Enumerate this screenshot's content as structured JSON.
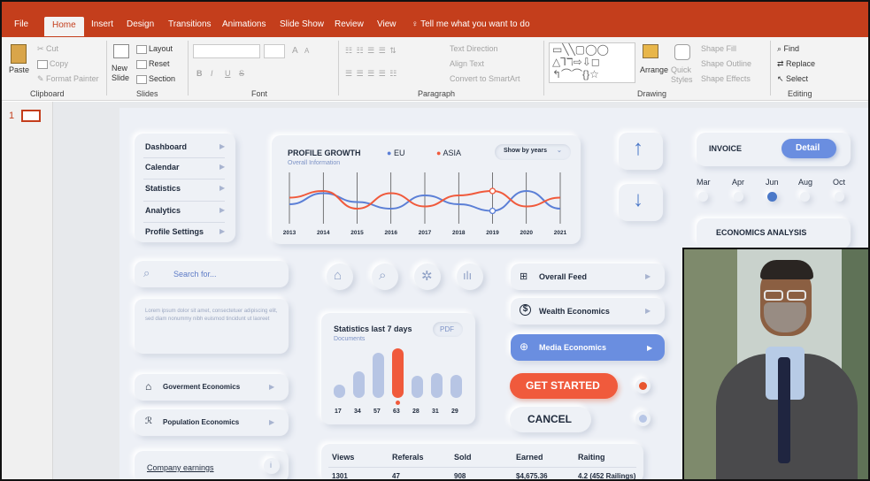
{
  "ribbon": {
    "tabs": [
      "File",
      "Home",
      "Insert",
      "Design",
      "Transitions",
      "Animations",
      "Slide Show",
      "Review",
      "View"
    ],
    "tell_me": "Tell me what you want to do",
    "clipboard": {
      "paste": "Paste",
      "cut": "Cut",
      "copy": "Copy",
      "format_painter": "Format Painter",
      "label": "Clipboard"
    },
    "slides": {
      "new_slide": "New Slide",
      "layout": "Layout",
      "reset": "Reset",
      "section": "Section",
      "label": "Slides"
    },
    "font": {
      "label": "Font",
      "bold": "B",
      "italic": "I",
      "underline": "U",
      "strike": "S",
      "size_up": "A",
      "size_down": "A"
    },
    "paragraph": {
      "label": "Paragraph",
      "text_direction": "Text Direction",
      "align_text": "Align Text",
      "convert": "Convert to SmartArt"
    },
    "drawing": {
      "label": "Drawing",
      "arrange": "Arrange",
      "quick_styles": "Quick Styles",
      "shape_fill": "Shape Fill",
      "shape_outline": "Shape Outline",
      "shape_effects": "Shape Effects"
    },
    "editing": {
      "label": "Editing",
      "find": "Find",
      "replace": "Replace",
      "select": "Select"
    }
  },
  "thumbs": {
    "slide_number": "1"
  },
  "slide": {
    "menu": [
      "Dashboard",
      "Calendar",
      "Statistics",
      "Analytics",
      "Profile Settings"
    ],
    "chart": {
      "title": "PROFILE GROWTH",
      "subtitle": "Overall Information",
      "legend_eu": "EU",
      "legend_asia": "ASIA",
      "dropdown": "Show by years",
      "years": [
        "2013",
        "2014",
        "2015",
        "2016",
        "2017",
        "2018",
        "2019",
        "2020",
        "2021"
      ]
    },
    "search_placeholder": "Search for...",
    "lorem": "Lorem ipsum dolor sit amet, consectetuer adipiscing elit, sed diam nonummy nibh euismod tincidunt ut laoreet",
    "feeds": [
      {
        "icon": "⊞",
        "label": "Overall Feed"
      },
      {
        "icon": "$",
        "label": "Wealth Economics"
      },
      {
        "icon": "⊕",
        "label": "Media Economics"
      }
    ],
    "stats": {
      "title": "Statistics last 7 days",
      "subtitle": "Documents",
      "badge": "PDF",
      "values": [
        "17",
        "34",
        "57",
        "63",
        "28",
        "31",
        "29"
      ]
    },
    "econ": [
      {
        "icon": "⌂",
        "label": "Goverment Economics"
      },
      {
        "icon": "ℛ",
        "label": "Population Economics"
      }
    ],
    "company": "Company earnings",
    "buttons": {
      "get_started": "GET STARTED",
      "cancel": "CANCEL"
    },
    "invoice": {
      "label": "INVOICE",
      "detail": "Detail",
      "months": [
        "Mar",
        "Apr",
        "Jun",
        "Aug",
        "Oct"
      ]
    },
    "econ_analysis": "ECONOMICS ANALYSIS",
    "table": {
      "headers": [
        "Views",
        "Referals",
        "Sold",
        "Earned",
        "Raiting"
      ],
      "row": [
        "1301",
        "47",
        "908",
        "$4,675.36",
        "4.2 (452 Railings)"
      ]
    }
  },
  "chart_data": {
    "type": "line",
    "x": [
      "2013",
      "2014",
      "2015",
      "2016",
      "2017",
      "2018",
      "2019",
      "2020",
      "2021"
    ],
    "series": [
      {
        "name": "EU",
        "values": [
          40,
          65,
          45,
          30,
          60,
          40,
          25,
          70,
          30
        ]
      },
      {
        "name": "ASIA",
        "values": [
          55,
          70,
          30,
          65,
          35,
          60,
          70,
          35,
          55
        ]
      }
    ],
    "title": "PROFILE GROWTH"
  },
  "colors": {
    "accent": "#c43e1c",
    "eu": "#5b7fd6",
    "asia": "#f05a3c",
    "highlight": "#6a8ee0"
  }
}
